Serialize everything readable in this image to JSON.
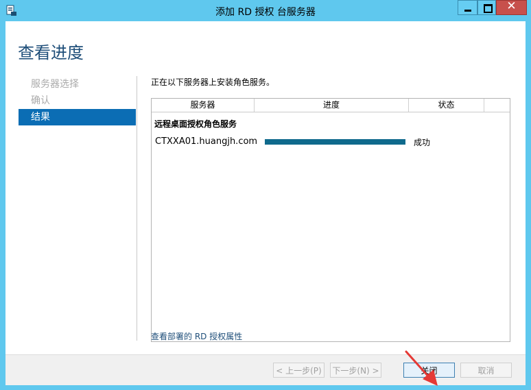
{
  "window": {
    "title": "添加 RD 授权 台服务器",
    "close_glyph": "✕",
    "icon": "server-manager-icon",
    "close_color": "#c7504c",
    "titlebar_color": "#5fc8ee"
  },
  "page": {
    "title": "查看进度"
  },
  "nav": {
    "items": [
      {
        "label": "服务器选择",
        "active": false
      },
      {
        "label": "确认",
        "active": false
      },
      {
        "label": "结果",
        "active": true
      }
    ]
  },
  "main": {
    "description": "正在以下服务器上安装角色服务。",
    "table": {
      "headers": [
        "服务器",
        "进度",
        "状态"
      ],
      "group_label": "远程桌面授权角色服务",
      "rows": [
        {
          "server": "CTXXA01.huangjh.com",
          "progress": 1.0,
          "status": "成功"
        }
      ]
    },
    "link": "查看部署的 RD 授权属性"
  },
  "footer": {
    "prev": "< 上一步(P)",
    "next": "下一步(N) >",
    "close": "关闭",
    "cancel": "取消"
  },
  "accent_color": "#0b6db4",
  "progress_color": "#0f6a8c",
  "annotation_arrow_color": "#e53935"
}
